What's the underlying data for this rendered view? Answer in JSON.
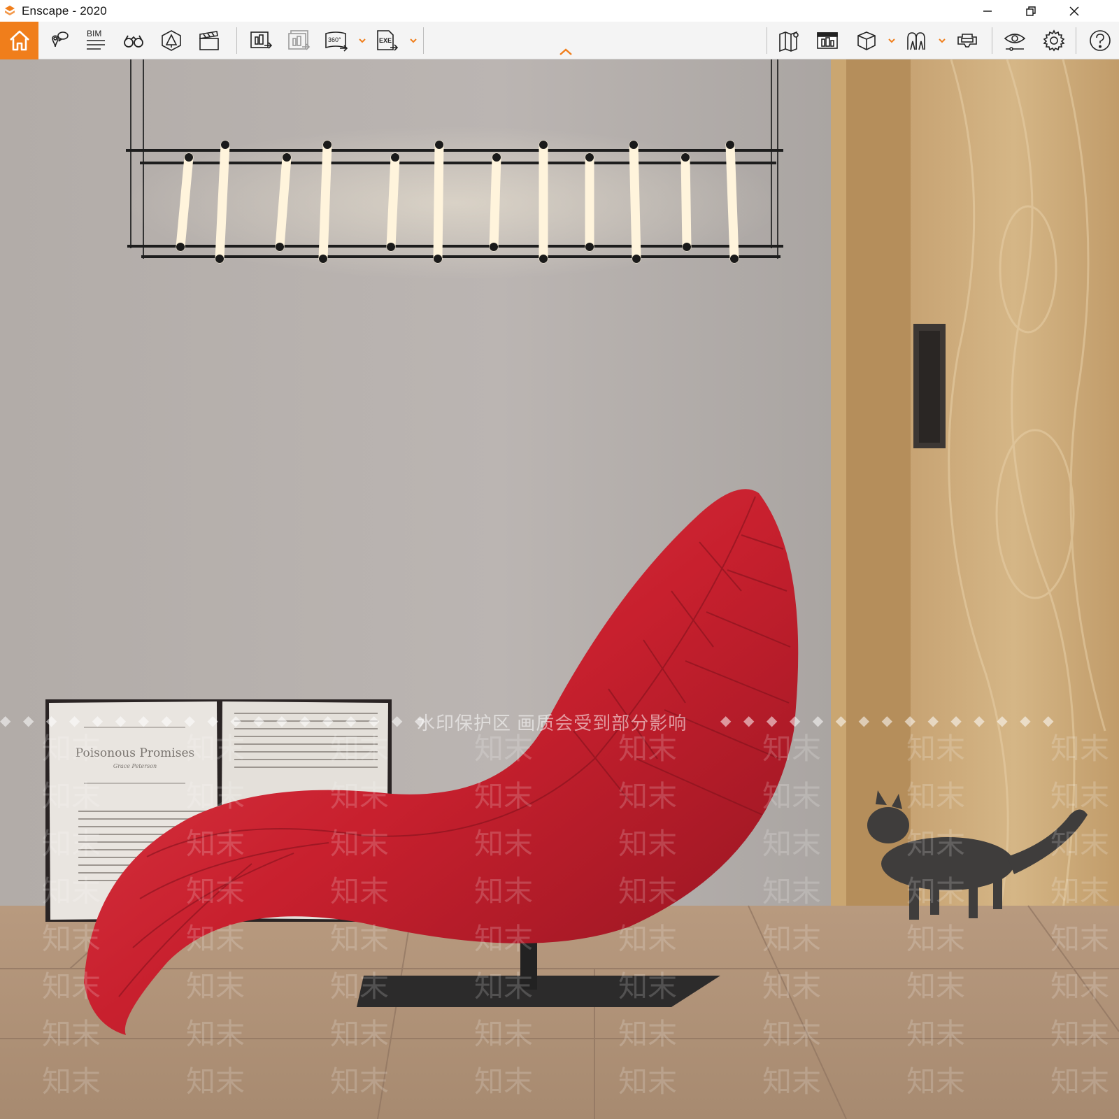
{
  "window": {
    "title": "Enscape - 2020",
    "controls": [
      "minimize",
      "restore",
      "close"
    ]
  },
  "toolbar": {
    "home_icon": "home-icon",
    "left_group": [
      {
        "name": "views-icon"
      },
      {
        "name": "bim-icon",
        "label": "BIM"
      },
      {
        "name": "binoculars-icon"
      },
      {
        "name": "asset-library-icon"
      },
      {
        "name": "video-editor-icon"
      }
    ],
    "export_group": [
      {
        "name": "screenshot-export-icon"
      },
      {
        "name": "batch-render-icon"
      },
      {
        "name": "panorama-export-icon",
        "label": "360°"
      },
      {
        "name": "exe-export-icon",
        "label": "EXE"
      }
    ],
    "right_group": [
      {
        "name": "map-icon"
      },
      {
        "name": "orthographic-icon"
      },
      {
        "name": "cube-icon"
      },
      {
        "name": "collaboration-icon"
      },
      {
        "name": "vr-headset-icon"
      },
      {
        "name": "eye-settings-icon"
      },
      {
        "name": "gear-icon"
      },
      {
        "name": "help-icon"
      }
    ],
    "accent_color": "#f07e1b"
  },
  "viewport": {
    "watermark_banner": "水印保护区   画质会受到部分影响",
    "watermark_tile": "知末",
    "book": {
      "title": "Poisonous Promises",
      "author": "Grace Peterson"
    }
  }
}
